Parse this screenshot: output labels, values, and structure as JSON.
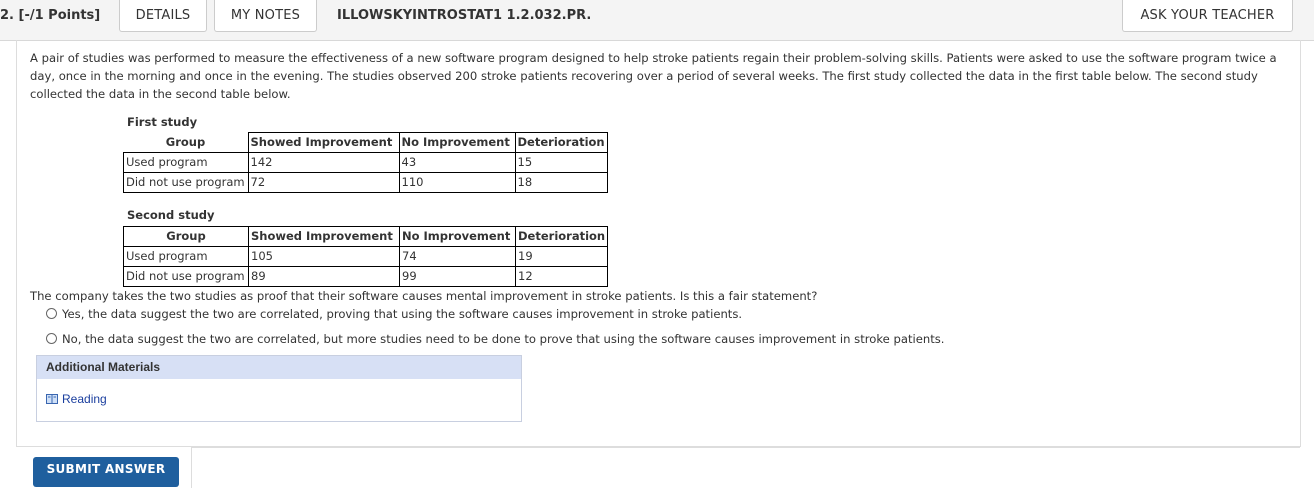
{
  "header": {
    "question_number": "2. [-/1 Points]",
    "details_label": "DETAILS",
    "my_notes_label": "MY NOTES",
    "question_code": "ILLOWSKYINTROSTAT1 1.2.032.PR.",
    "ask_teacher_label": "ASK YOUR TEACHER"
  },
  "problem": {
    "text": "A pair of studies was performed to measure the effectiveness of a new software program designed to help stroke patients regain their problem-solving skills. Patients were asked to use the software program twice a day, once in the morning and once in the evening. The studies observed 200 stroke patients recovering over a period of several weeks. The first study collected the data in the first table below. The second study collected the data in the second table below."
  },
  "first_study": {
    "caption": "First study",
    "headers": [
      "Group",
      "Showed Improvement",
      "No Improvement",
      "Deterioration"
    ],
    "rows": [
      [
        "Used program",
        "142",
        "43",
        "15"
      ],
      [
        "Did not use program",
        "72",
        "110",
        "18"
      ]
    ]
  },
  "second_study": {
    "caption": "Second study",
    "headers": [
      "Group",
      "Showed Improvement",
      "No Improvement",
      "Deterioration"
    ],
    "rows": [
      [
        "Used program",
        "105",
        "74",
        "19"
      ],
      [
        "Did not use program",
        "89",
        "99",
        "12"
      ]
    ]
  },
  "question": {
    "text": "The company takes the two studies as proof that their software causes mental improvement in stroke patients. Is this a fair statement?",
    "options": [
      "Yes, the data suggest the two are correlated, proving that using the software causes improvement in stroke patients.",
      "No, the data suggest the two are correlated, but more studies need to be done to prove that using the software causes improvement in stroke patients."
    ]
  },
  "additional_materials": {
    "title": "Additional Materials",
    "link_label": "Reading"
  },
  "submit_label": "SUBMIT ANSWER"
}
